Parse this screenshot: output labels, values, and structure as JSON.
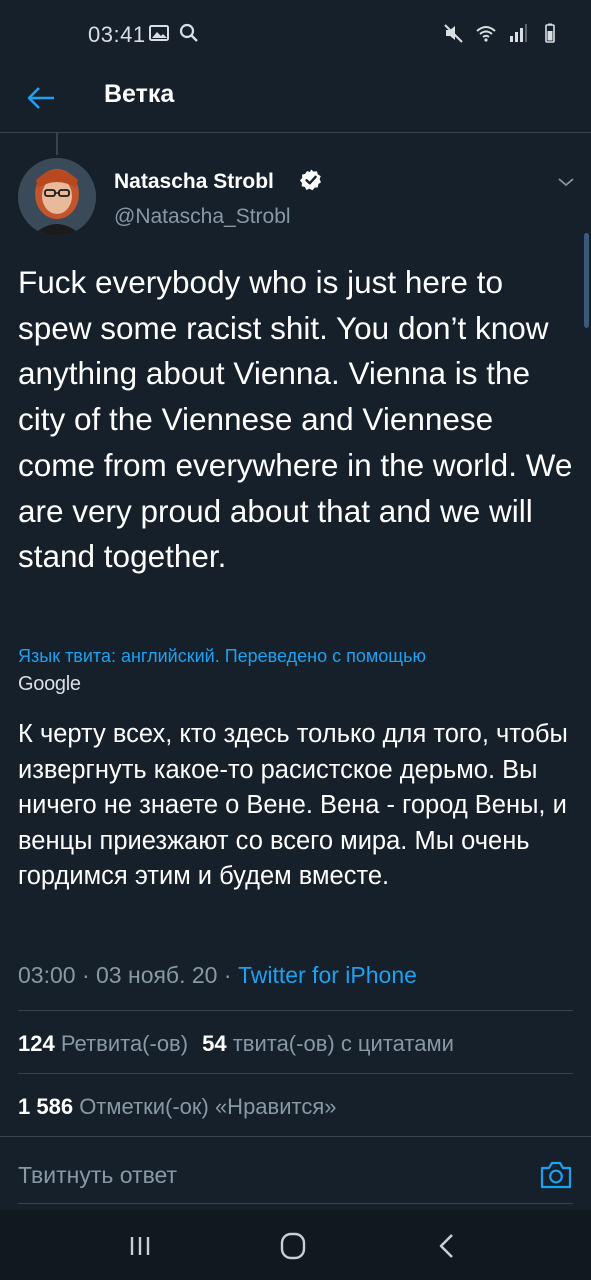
{
  "status_bar": {
    "time": "03:41",
    "left_icons": [
      "image-icon",
      "search-icon"
    ],
    "right_icons": [
      "mute-icon",
      "wifi-icon",
      "signal-icon",
      "battery-icon"
    ]
  },
  "header": {
    "back_icon": "arrow-left-icon",
    "title": "Ветка"
  },
  "tweet": {
    "author_name": "Natascha Strobl",
    "author_handle": "@Natascha_Strobl",
    "verified": true,
    "text": "Fuck everybody who is just here to spew some racist shit. You don’t know anything about Vienna. Vienna is the city of the Viennese and Viennese come from everywhere in the world. We are very proud about that and we will stand together.",
    "translation_note": "Язык твита: английский. Переведено с помощью",
    "translation_provider": "Google",
    "translated_text": "К черту всех, кто здесь только для того, чтобы извергнуть какое-то расистское дерьмо. Вы ничего не знаете о Вене. Вена - город Вены, и венцы приезжают со всего мира. Мы очень гордимся этим и будем вместе.",
    "time": "03:00",
    "date": "03 нояб. 20",
    "separator": "·",
    "source": "Twitter for iPhone"
  },
  "stats": {
    "retweets_count": "124",
    "retweets_label": "Ретвита(-ов)",
    "quotes_count": "54",
    "quotes_label": "твита(-ов) с цитатами",
    "likes_count": "1 586",
    "likes_label": "Отметки(-ок) «Нравится»"
  },
  "reply": {
    "placeholder": "Твитнуть ответ",
    "camera_icon": "camera-icon"
  },
  "nav_bar": {
    "buttons": [
      "recent-apps-icon",
      "home-icon",
      "back-icon"
    ]
  },
  "colors": {
    "background": "#15202b",
    "accent": "#1da1f2",
    "secondary_text": "#8899a6",
    "divider": "#38444d"
  }
}
